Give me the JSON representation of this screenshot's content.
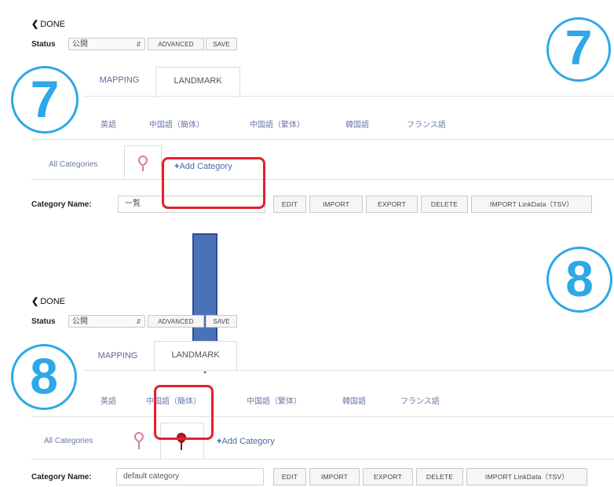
{
  "panels": [
    {
      "step_number": "7",
      "done": "DONE",
      "status_label": "Status",
      "status_value": "公開",
      "advanced": "ADVANCED",
      "save": "SAVE",
      "tabs": [
        "MAPPING",
        "LANDMARK"
      ],
      "languages": [
        "英語",
        "中国語（簡体）",
        "中国語（繁体）",
        "韓国語",
        "フランス語"
      ],
      "all_categories": "All Categories",
      "add_category": "Add Category",
      "category_name_label": "Category Name:",
      "category_name_value": "一覧",
      "actions": [
        "EDIT",
        "IMPORT",
        "EXPORT",
        "DELETE",
        "IMPORT LinkData（TSV）"
      ]
    },
    {
      "step_number": "8",
      "done": "DONE",
      "status_label": "Status",
      "status_value": "公開",
      "advanced": "ADVANCED",
      "save": "SAVE",
      "tabs": [
        "MAPPING",
        "LANDMARK"
      ],
      "languages": [
        "英語",
        "中国語（簡体）",
        "中国語（繁体）",
        "韓国語",
        "フランス語"
      ],
      "all_categories": "All Categories",
      "add_category": "Add Category",
      "category_name_label": "Category Name:",
      "category_name_value": "default category",
      "actions": [
        "EDIT",
        "IMPORT",
        "EXPORT",
        "DELETE",
        "IMPORT LinkData（TSV）"
      ]
    }
  ],
  "colors": {
    "accent_circle": "#2ea8e6",
    "highlight_box": "#e5202a",
    "arrow": "#4a72b8"
  },
  "icons": [
    "chevron-left-icon",
    "select-arrows-icon",
    "map-pin-icon",
    "plus-icon",
    "down-arrow-icon"
  ]
}
